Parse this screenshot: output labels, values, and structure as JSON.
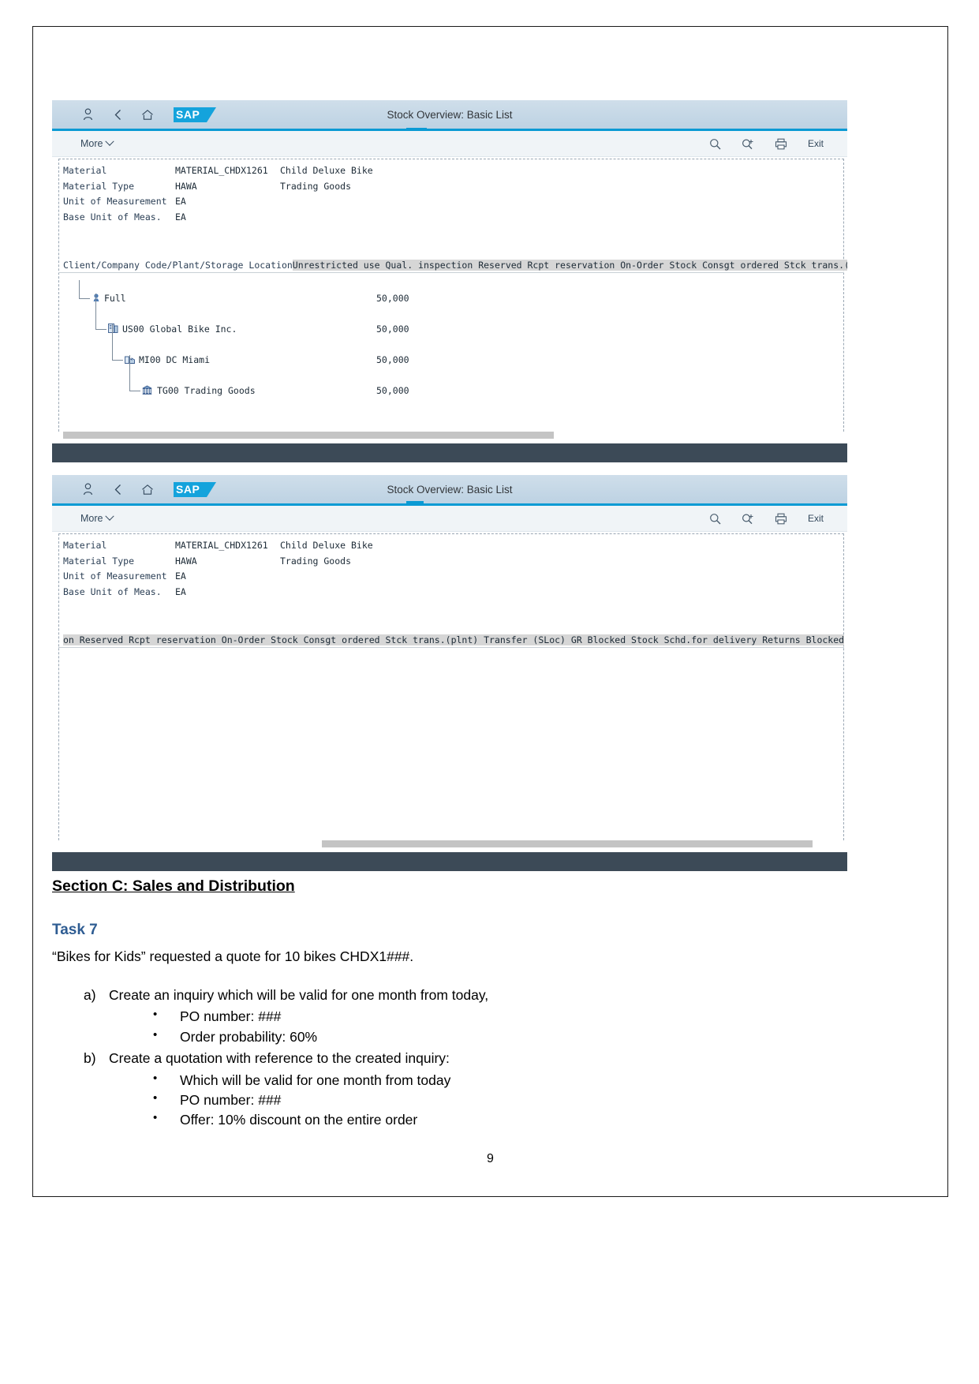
{
  "document": {
    "page_number": "9",
    "section_heading": "Section C: Sales and Distribution",
    "task_heading": "Task 7",
    "intro": "“Bikes for Kids” requested a quote for 10 bikes CHDX1###.",
    "items": [
      {
        "marker": "a)",
        "text": "Create an inquiry which will be valid for one month from today,",
        "bullets": [
          "PO number:  ###",
          "Order probability: 60%"
        ]
      },
      {
        "marker": "b)",
        "text": "Create a quotation with reference to the created inquiry:",
        "bullets": [
          "Which will be valid for one month from today",
          "PO number: ###",
          "Offer: 10% discount on the entire order"
        ]
      }
    ]
  },
  "screenshots": [
    {
      "title": "Stock Overview: Basic List",
      "logo_text": "SAP",
      "toolbar": {
        "more_label": "More",
        "exit_label": "Exit",
        "icons": [
          "search-icon",
          "search-next-icon",
          "print-icon"
        ]
      },
      "header_icons": [
        "user-icon",
        "back-icon",
        "home-icon"
      ],
      "meta": [
        {
          "label": "Material",
          "value1": "MATERIAL_CHDX1261",
          "value2": "Child Deluxe Bike"
        },
        {
          "label": "Material Type",
          "value1": "HAWA",
          "value2": "Trading Goods"
        },
        {
          "label": "Unit of Measurement",
          "value1": "EA",
          "value2": ""
        },
        {
          "label": "Base Unit of Meas.",
          "value1": "EA",
          "value2": ""
        }
      ],
      "column_header_key": "Client/Company Code/Plant/Storage Location",
      "column_header_rest": "Unrestricted use Qual. inspection Reserved Rcpt reservation On-Order Stock Consgt ordered Stck trans.(",
      "tree": [
        {
          "label": "Full",
          "value": "50,000",
          "icon": "client-icon",
          "indent": 0
        },
        {
          "label": "US00 Global Bike Inc.",
          "value": "50,000",
          "icon": "company-icon",
          "indent": 1
        },
        {
          "label": "MI00 DC Miami",
          "value": "50,000",
          "icon": "plant-icon",
          "indent": 2
        },
        {
          "label": "TG00 Trading Goods",
          "value": "50,000",
          "icon": "storage-icon",
          "indent": 3
        }
      ],
      "scroll": {
        "left_pct": 0.6,
        "width_pct": 62.5
      }
    },
    {
      "title": "Stock Overview: Basic List",
      "logo_text": "SAP",
      "toolbar": {
        "more_label": "More",
        "exit_label": "Exit",
        "icons": [
          "search-icon",
          "search-next-icon",
          "print-icon"
        ]
      },
      "header_icons": [
        "user-icon",
        "back-icon",
        "home-icon"
      ],
      "meta": [
        {
          "label": "Material",
          "value1": "MATERIAL_CHDX1261",
          "value2": "Child Deluxe Bike"
        },
        {
          "label": "Material Type",
          "value1": "HAWA",
          "value2": "Trading Goods"
        },
        {
          "label": "Unit of Measurement",
          "value1": "EA",
          "value2": ""
        },
        {
          "label": "Base Unit of Meas.",
          "value1": "EA",
          "value2": ""
        }
      ],
      "column_header_key": "",
      "column_header_rest": "on Reserved Rcpt reservation On-Order Stock Consgt ordered Stck trans.(plnt) Transfer (SLoc) GR Blocked Stock Schd.for delivery Returns Blocked",
      "tree": [],
      "scroll": {
        "left_pct": 33.5,
        "width_pct": 62.5
      }
    }
  ],
  "colors": {
    "accent": "#0a9ad4",
    "header_gradient_top": "#cfdeea",
    "header_gradient_bottom": "#bdd2e3",
    "footer": "#3c4a57",
    "task_heading": "#2e5c92",
    "mono_text": "#1c2a36",
    "label_text": "#2b3f55"
  }
}
